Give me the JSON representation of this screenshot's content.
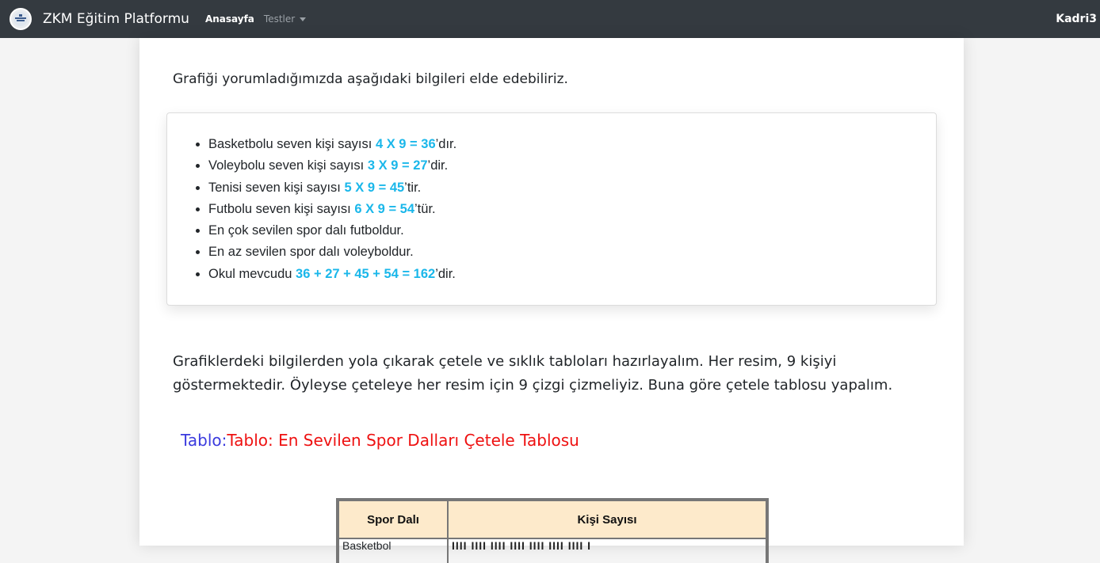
{
  "navbar": {
    "brand": "ZKM Eğitim Platformu",
    "links": [
      "Anasayfa",
      "Testler"
    ],
    "user": "Kadri3"
  },
  "main": {
    "intro": "Grafiği yorumladığımızda aşağıdaki bilgileri elde edebiliriz.",
    "list": [
      {
        "pre": "Basketbolu seven kişi sayısı ",
        "hl": "4 X 9 = 36",
        "post": "’dır."
      },
      {
        "pre": "Voleybolu seven kişi sayısı ",
        "hl": "3 X 9 = 27",
        "post": "’dir."
      },
      {
        "pre": "Tenisi seven kişi sayısı ",
        "hl": "5 X 9 = 45",
        "post": "’tir."
      },
      {
        "pre": "Futbolu seven kişi sayısı ",
        "hl": "6 X 9 = 54",
        "post": "’tür."
      },
      {
        "pre": "En çok sevilen spor dalı futboldur.",
        "hl": "",
        "post": ""
      },
      {
        "pre": "En az sevilen spor dalı voleyboldur.",
        "hl": "",
        "post": ""
      },
      {
        "pre": "Okul mevcudu ",
        "hl": "36 + 27 + 45 + 54 = 162",
        "post": "’dir."
      }
    ],
    "paragraph": "Grafiklerdeki bilgilerden yola çıkarak çetele ve sıklık tabloları hazırlayalım. Her resim, 9 kişiyi göstermektedir. Öyleyse çeteleye her resim için 9 çizgi çizmeliyiz. Buna göre çetele tablosu yapalım.",
    "table_title_label": "Tablo:",
    "table_title_text": "Tablo: En Sevilen Spor Dalları Çetele Tablosu",
    "table_headers": [
      "Spor Dalı",
      "Kişi Sayısı"
    ],
    "first_row_label": "Basketbol",
    "first_row_marks": "IIII  IIII  IIII  IIII  IIII  IIII  IIII  I"
  },
  "colors": {
    "navbar": "#343a40",
    "highlight": "#1ab7ea",
    "title_label": "#3b3bde",
    "title_text": "#ee1111",
    "table_header": "#fdeacb"
  }
}
